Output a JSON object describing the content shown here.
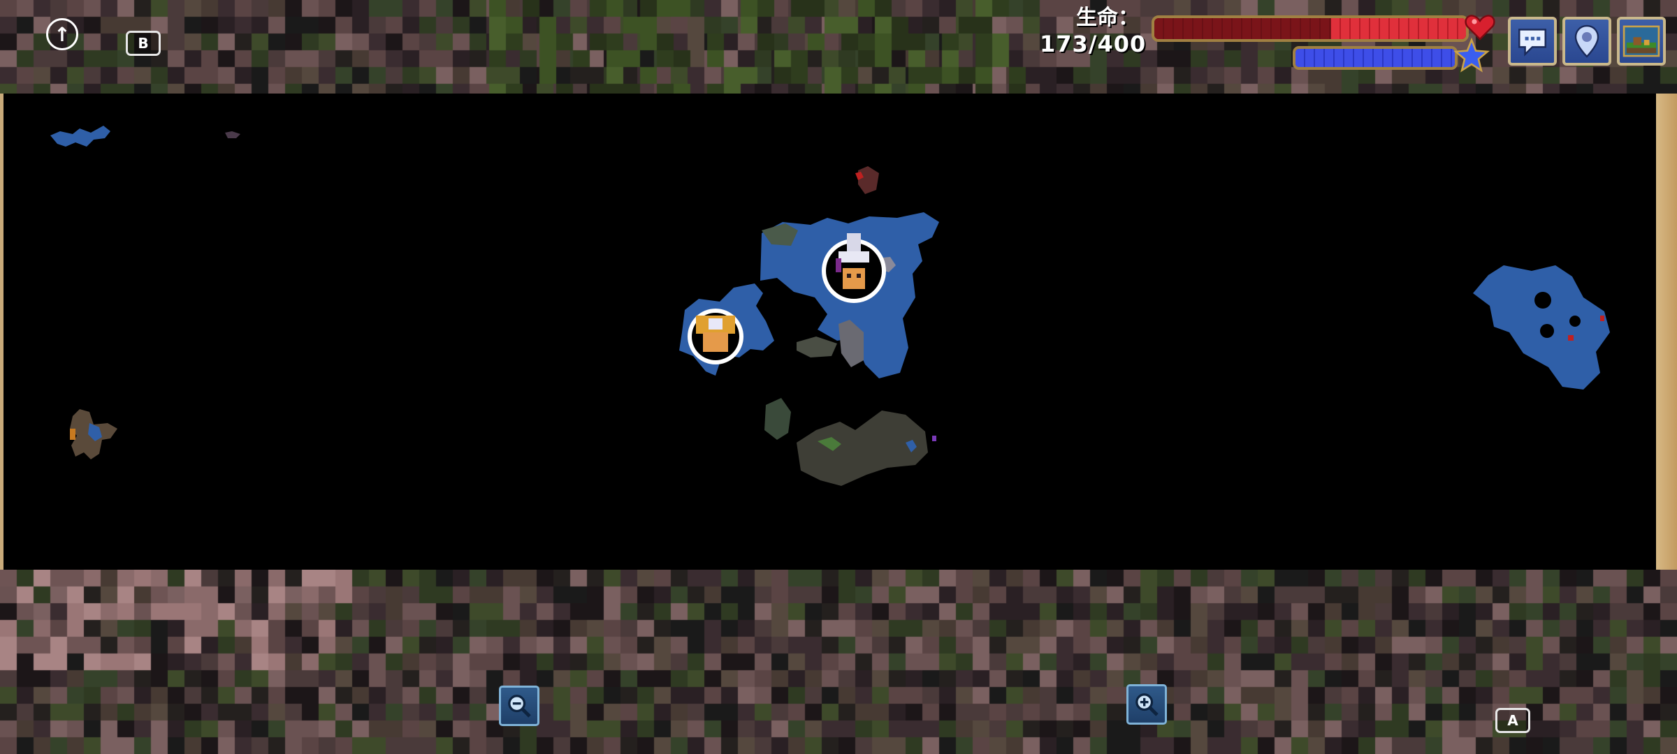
{
  "hud": {
    "up_button_glyph": "↑",
    "key_b_label": "B",
    "key_a_label": "A",
    "life_label": "生命：",
    "life_value": "173/400",
    "life_current": 173,
    "life_max": 400,
    "mana_fraction": 1.0
  },
  "buttons": {
    "chat_icon": "chat-bubble-icon",
    "map_pin_icon": "map-pin-icon",
    "world_icon": "world-map-icon",
    "zoom_out_icon": "zoom-out-icon",
    "zoom_in_icon": "zoom-in-icon"
  },
  "colors": {
    "health": "#e0303b",
    "mana": "#3e4ee8",
    "map_water": "#2f5fa8",
    "map_background": "#000000",
    "frame_gold": "#a08042"
  }
}
